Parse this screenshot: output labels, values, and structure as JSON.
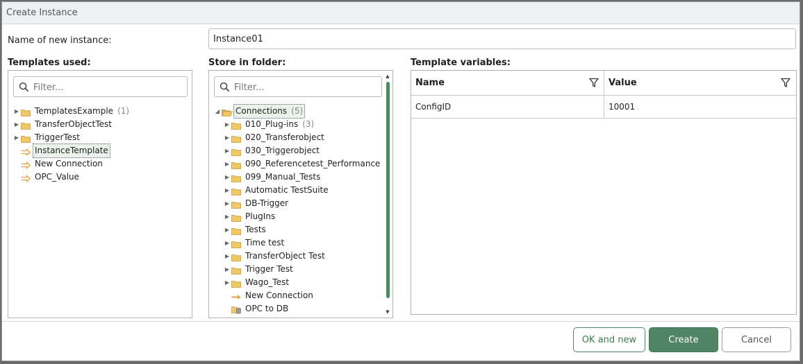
{
  "dialog": {
    "title": "Create Instance"
  },
  "name_field": {
    "label": "Name of new instance:",
    "value": "Instance01"
  },
  "templates": {
    "heading": "Templates used:",
    "filter_placeholder": "Filter...",
    "items": [
      {
        "label": "TemplatesExample",
        "count": "(1)",
        "type": "folder",
        "expandable": true
      },
      {
        "label": "TransferObjectTest",
        "count": "",
        "type": "folder",
        "expandable": true
      },
      {
        "label": "TriggerTest",
        "count": "",
        "type": "folder",
        "expandable": true
      },
      {
        "label": "InstanceTemplate",
        "count": "",
        "type": "template",
        "expandable": false,
        "selected": true
      },
      {
        "label": "New Connection",
        "count": "",
        "type": "template",
        "expandable": false
      },
      {
        "label": "OPC_Value",
        "count": "",
        "type": "template",
        "expandable": false
      }
    ]
  },
  "folders": {
    "heading": "Store in folder:",
    "filter_placeholder": "Filter...",
    "root": {
      "label": "Connections",
      "count": "(5)"
    },
    "items": [
      {
        "label": "010_Plug-ins",
        "count": "(3)",
        "type": "folder"
      },
      {
        "label": "020_Transferobject",
        "count": "",
        "type": "folder"
      },
      {
        "label": "030_Triggerobject",
        "count": "",
        "type": "folder"
      },
      {
        "label": "090_Referencetest_Performance",
        "count": "",
        "type": "folder"
      },
      {
        "label": "099_Manual_Tests",
        "count": "",
        "type": "folder"
      },
      {
        "label": "Automatic TestSuite",
        "count": "",
        "type": "folder"
      },
      {
        "label": "DB-Trigger",
        "count": "",
        "type": "folder"
      },
      {
        "label": "PlugIns",
        "count": "",
        "type": "folder"
      },
      {
        "label": "Tests",
        "count": "",
        "type": "folder"
      },
      {
        "label": "Time test",
        "count": "",
        "type": "folder"
      },
      {
        "label": "TransferObject Test",
        "count": "",
        "type": "folder"
      },
      {
        "label": "Trigger Test",
        "count": "",
        "type": "folder"
      },
      {
        "label": "Wago_Test",
        "count": "",
        "type": "folder"
      },
      {
        "label": "New Connection",
        "count": "",
        "type": "connection"
      },
      {
        "label": "OPC to DB",
        "count": "",
        "type": "database"
      }
    ]
  },
  "variables": {
    "heading": "Template variables:",
    "columns": {
      "name": "Name",
      "value": "Value"
    },
    "rows": [
      {
        "name": "ConfigID",
        "value": "10001"
      }
    ]
  },
  "buttons": {
    "ok_and_new": "OK and new",
    "create": "Create",
    "cancel": "Cancel"
  },
  "colors": {
    "accent": "#4f8464",
    "folder": "#f0c866",
    "template_arrow": "#e0a24a"
  }
}
